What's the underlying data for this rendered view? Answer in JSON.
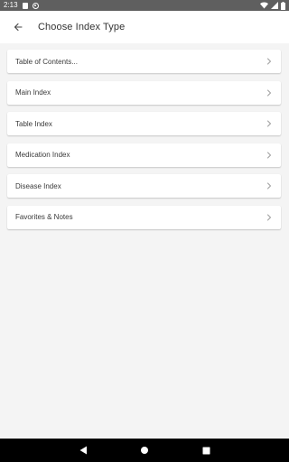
{
  "status_bar": {
    "time": "2:13",
    "left_icons": [
      "notification-square-icon",
      "data-saver-icon"
    ],
    "right_icons": [
      "wifi-icon",
      "signal-icon",
      "battery-icon"
    ]
  },
  "app_bar": {
    "back_icon": "arrow-left-icon",
    "title": "Choose Index Type"
  },
  "index_items": [
    {
      "label": "Table of Contents...",
      "icon": "chevron-right-icon"
    },
    {
      "label": "Main Index",
      "icon": "chevron-right-icon"
    },
    {
      "label": "Table Index",
      "icon": "chevron-right-icon"
    },
    {
      "label": "Medication Index",
      "icon": "chevron-right-icon"
    },
    {
      "label": "Disease Index",
      "icon": "chevron-right-icon"
    },
    {
      "label": "Favorites & Notes",
      "icon": "chevron-right-icon"
    }
  ],
  "nav_bar": {
    "buttons": [
      "back-triangle-icon",
      "home-circle-icon",
      "recents-square-icon"
    ]
  },
  "colors": {
    "status_bar_bg": "#5f5f5f",
    "app_bar_bg": "#ffffff",
    "page_bg": "#f4f4f4",
    "card_bg": "#ffffff",
    "nav_bar_bg": "#000000"
  }
}
